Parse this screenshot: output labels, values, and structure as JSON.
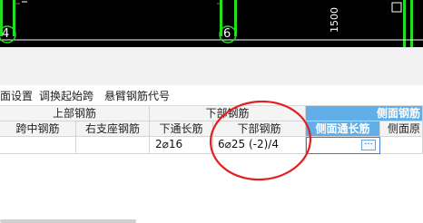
{
  "cad": {
    "axis_left": "4",
    "axis_right": "6",
    "dim_text": "1500"
  },
  "toolbar": {
    "items": [
      "面设置",
      "调换起始跨",
      "悬臂钢筋代号"
    ]
  },
  "table": {
    "group_headers": {
      "top_rebar": "上部钢筋",
      "bottom_rebar": "下部钢筋",
      "side_rebar": "侧面钢筋"
    },
    "column_headers": {
      "mid_span": "跨中钢筋",
      "right_support": "右支座钢筋",
      "bottom_through": "下通长筋",
      "bottom_rebar": "下部钢筋",
      "side_through": "侧面通长筋",
      "side_original": "侧面原"
    },
    "row": {
      "mid_span": "",
      "right_support": "",
      "bottom_through": "2⌀16",
      "bottom_rebar": "6⌀25 (-2)/4",
      "side_through": "",
      "side_original": ""
    },
    "ellipsis_label": "···"
  },
  "colors": {
    "cad_background": "#000000",
    "cad_green": "#22dd22",
    "cad_white": "#ffffff",
    "header_blue": "#62aee8",
    "annotation_red": "#e02020"
  }
}
